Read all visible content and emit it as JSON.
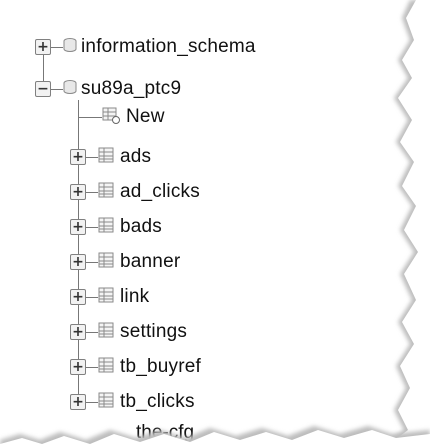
{
  "databases": [
    {
      "name": "information_schema",
      "expanded": false
    },
    {
      "name": "su89a_ptc9",
      "expanded": true
    }
  ],
  "new_item": {
    "label": "New"
  },
  "tables": [
    "ads",
    "ad_clicks",
    "bads",
    "banner",
    "link",
    "settings",
    "tb_buyref",
    "tb_clicks"
  ],
  "truncated_item": "the-cfg",
  "icons": {
    "expand": "plus-expander-icon",
    "collapse": "minus-expander-icon",
    "database": "database-icon",
    "table": "table-icon",
    "new": "new-table-icon"
  }
}
